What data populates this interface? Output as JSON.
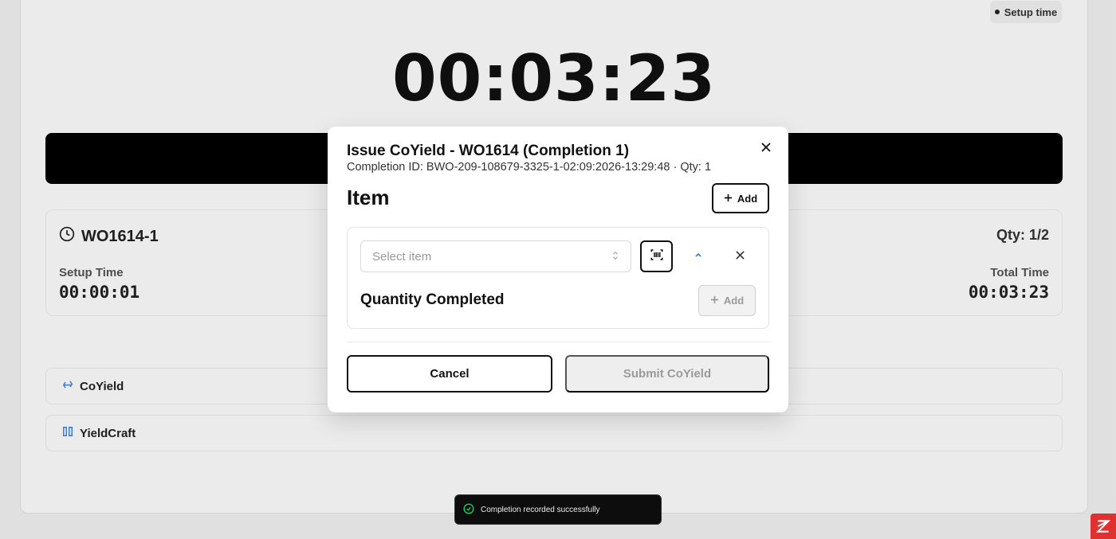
{
  "status_chip": {
    "label": "Setup time"
  },
  "timer": {
    "value": "00:03:23"
  },
  "work_order": {
    "title": "WO1614-1",
    "qty": "Qty: 1/2",
    "setup_label": "Setup Time",
    "setup_value": "00:00:01",
    "total_label": "Total Time",
    "total_value": "00:03:23"
  },
  "apps": [
    {
      "name": "CoYield",
      "icon": "recycle-icon"
    },
    {
      "name": "YieldCraft",
      "icon": "columns-icon"
    }
  ],
  "modal": {
    "title": "Issue CoYield - WO1614 (Completion 1)",
    "subtitle": "Completion ID: BWO-209-108679-3325-1-02:09:2026-13:29:48 · Qty: 1",
    "section_title": "Item",
    "add_label": "Add",
    "select_placeholder": "Select item",
    "quantity_title": "Quantity Completed",
    "quantity_add_label": "Add",
    "cancel_label": "Cancel",
    "submit_label": "Submit CoYield"
  },
  "toast": {
    "message": "Completion recorded successfully"
  },
  "colors": {
    "accent": "#111111",
    "brand_corner": "#e03131",
    "success": "#22c55e",
    "app_icon": "#3b82f6"
  }
}
